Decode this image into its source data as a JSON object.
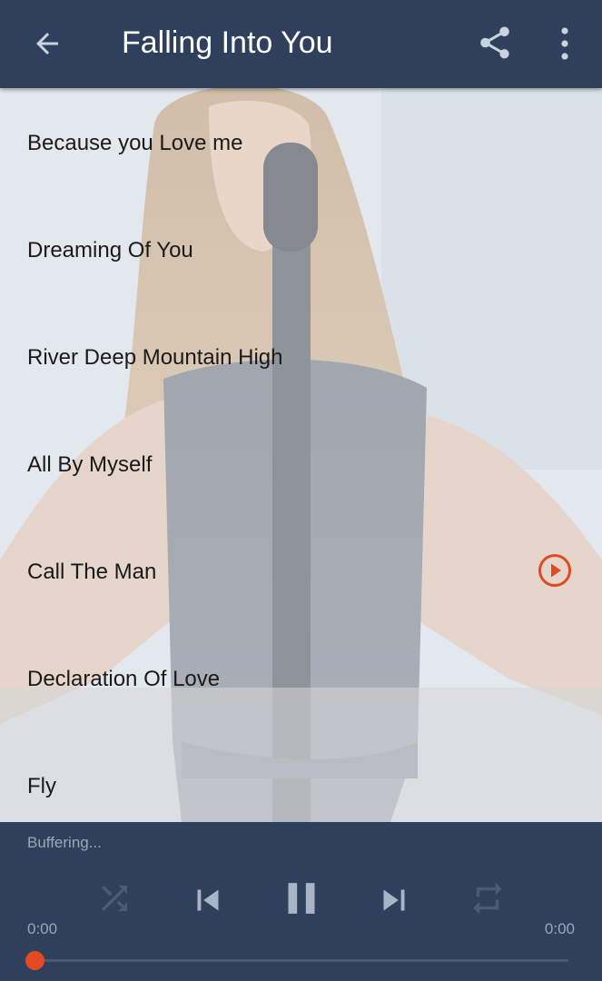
{
  "header": {
    "title": "Falling Into You"
  },
  "songs": [
    {
      "label": "Because you Love me"
    },
    {
      "label": "Dreaming Of You"
    },
    {
      "label": "River Deep Mountain High"
    },
    {
      "label": "All By Myself"
    },
    {
      "label": "Call The Man",
      "playing": true
    },
    {
      "label": "Declaration Of Love"
    },
    {
      "label": "Fly"
    }
  ],
  "player": {
    "status": "Buffering...",
    "elapsed": "0:00",
    "duration": "0:00",
    "progress": 0
  },
  "colors": {
    "bar": "#2e405b",
    "accent": "#e24a22",
    "muted": "#9aa7ba"
  }
}
